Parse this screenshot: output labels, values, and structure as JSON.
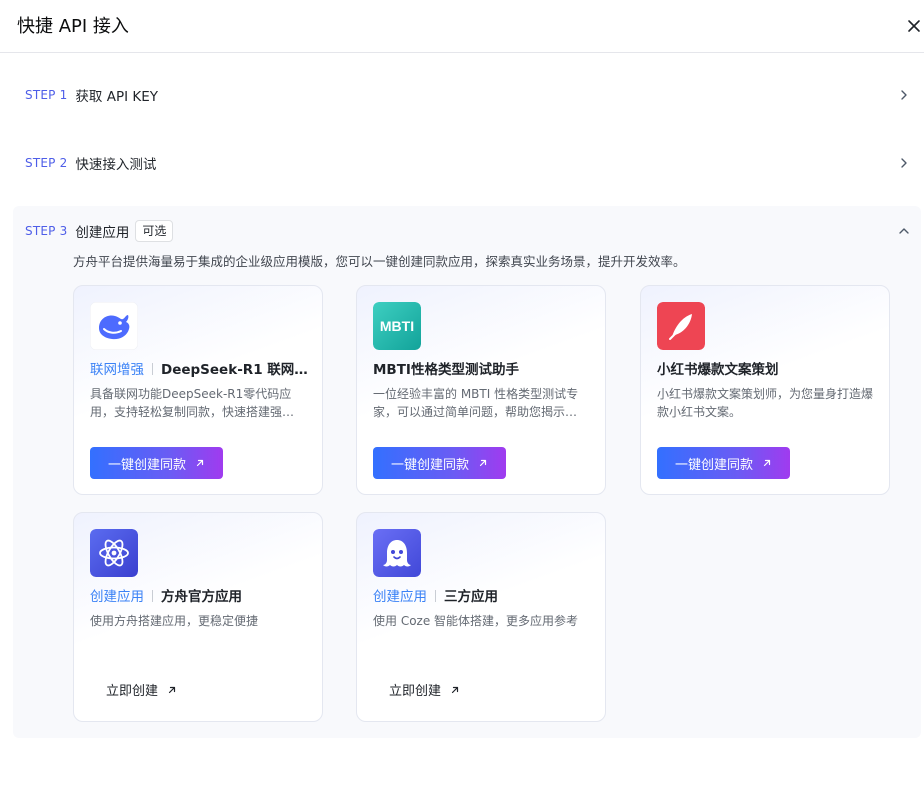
{
  "dialog": {
    "title": "快捷 API 接入"
  },
  "steps": [
    {
      "num": "STEP 1",
      "label": "获取 API KEY"
    },
    {
      "num": "STEP 2",
      "label": "快速接入测试"
    },
    {
      "num": "STEP 3",
      "label": "创建应用",
      "tag": "可选",
      "description": "方舟平台提供海量易于集成的企业级应用模版，您可以一键创建同款应用，探索真实业务场景，提升开发效率。"
    }
  ],
  "cards": [
    {
      "logo_icon": "deepseek-whale-icon",
      "tag": "联网增强",
      "title": "DeepSeek-R1 联网…",
      "description": "具备联网功能DeepSeek-R1零代码应用，支持轻松复制同款，快速搭建强…",
      "action": "一键创建同款"
    },
    {
      "logo_icon": "mbti-icon",
      "logo_text": "MBTI",
      "title": "MBTI性格类型测试助手",
      "description": "一位经验丰富的 MBTI 性格类型测试专家，可以通过简单问题，帮助您揭示…",
      "action": "一键创建同款"
    },
    {
      "logo_icon": "feather-icon",
      "title": "小红书爆款文案策划",
      "description": "小红书爆款文案策划师，为您量身打造爆款小红书文案。",
      "action": "一键创建同款"
    },
    {
      "logo_icon": "atom-icon",
      "tag": "创建应用",
      "title": "方舟官方应用",
      "description": "使用方舟搭建应用，更稳定便捷",
      "action": "立即创建"
    },
    {
      "logo_icon": "ghost-bot-icon",
      "tag": "创建应用",
      "title": "三方应用",
      "description": "使用 Coze 智能体搭建，更多应用参考",
      "action": "立即创建"
    }
  ],
  "colors": {
    "accent": "#3370ff",
    "step_num": "#4e5ee8",
    "tag_blue": "#3b82f6"
  }
}
